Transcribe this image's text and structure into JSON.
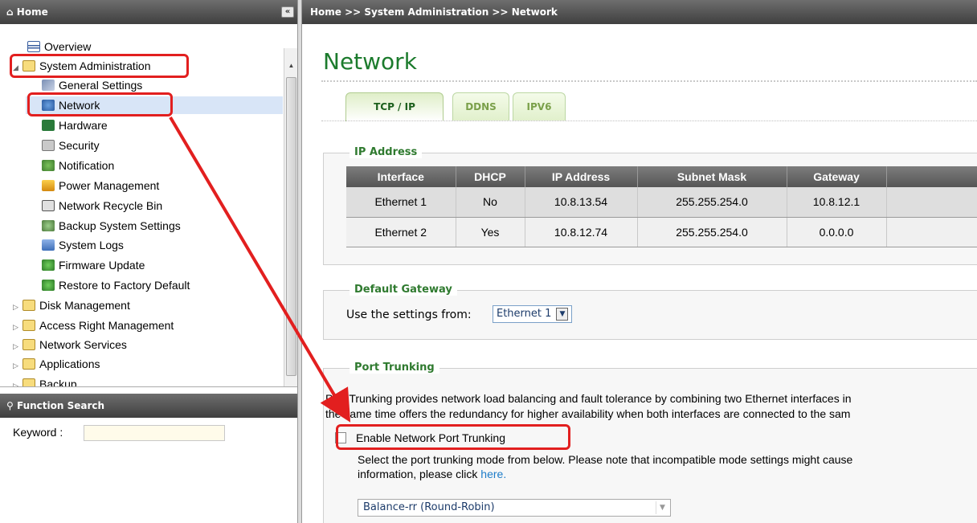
{
  "sidebar": {
    "header": "Home",
    "collapse_glyph": "«",
    "items": [
      {
        "label": "Overview",
        "icon": "overview-icon"
      },
      {
        "label": "System Administration",
        "icon": "folder-icon"
      },
      {
        "label": "General Settings",
        "icon": "settings-icon"
      },
      {
        "label": "Network",
        "icon": "network-icon"
      },
      {
        "label": "Hardware",
        "icon": "hardware-icon"
      },
      {
        "label": "Security",
        "icon": "security-icon"
      },
      {
        "label": "Notification",
        "icon": "notification-icon"
      },
      {
        "label": "Power Management",
        "icon": "power-icon"
      },
      {
        "label": "Network Recycle Bin",
        "icon": "recycle-bin-icon"
      },
      {
        "label": "Backup System Settings",
        "icon": "backup-icon"
      },
      {
        "label": "System Logs",
        "icon": "logs-icon"
      },
      {
        "label": "Firmware Update",
        "icon": "firmware-icon"
      },
      {
        "label": "Restore to Factory Default",
        "icon": "restore-icon"
      },
      {
        "label": "Disk Management",
        "icon": "folder-icon"
      },
      {
        "label": "Access Right Management",
        "icon": "folder-icon"
      },
      {
        "label": "Network Services",
        "icon": "folder-icon"
      },
      {
        "label": "Applications",
        "icon": "folder-icon"
      },
      {
        "label": "Backup",
        "icon": "folder-icon"
      }
    ]
  },
  "search": {
    "header": "Function Search",
    "keyword_label": "Keyword :",
    "keyword_value": ""
  },
  "main": {
    "breadcrumb": "Home >> System Administration >> Network",
    "title": "Network",
    "tabs": [
      {
        "label": "TCP / IP",
        "active": true
      },
      {
        "label": "DDNS",
        "active": false
      },
      {
        "label": "IPV6",
        "active": false
      }
    ],
    "ip_address": {
      "legend": "IP Address",
      "columns": [
        "Interface",
        "DHCP",
        "IP Address",
        "Subnet Mask",
        "Gateway"
      ],
      "rows": [
        [
          "Ethernet 1",
          "No",
          "10.8.13.54",
          "255.255.254.0",
          "10.8.12.1"
        ],
        [
          "Ethernet 2",
          "Yes",
          "10.8.12.74",
          "255.255.254.0",
          "0.0.0.0"
        ]
      ]
    },
    "default_gateway": {
      "legend": "Default Gateway",
      "label": "Use the settings from:",
      "selected": "Ethernet 1"
    },
    "port_trunking": {
      "legend": "Port Trunking",
      "line1": "Port Trunking provides network load balancing and fault tolerance by combining two Ethernet interfaces in",
      "line2": "the same time offers the redundancy for higher availability when both interfaces are connected to the sam",
      "checkbox_label": "Enable Network Port Trunking",
      "checked": false,
      "mode_text_line1": "Select the port trunking mode from below. Please note that incompatible mode settings might cause",
      "mode_text_line2": "information, please click",
      "link_text": "here.",
      "mode_selected": "Balance-rr (Round-Robin)"
    }
  },
  "colors": {
    "highlight": "#e21f1f",
    "title_green": "#1c7b2d",
    "header_gray": "#4f4f4f"
  }
}
